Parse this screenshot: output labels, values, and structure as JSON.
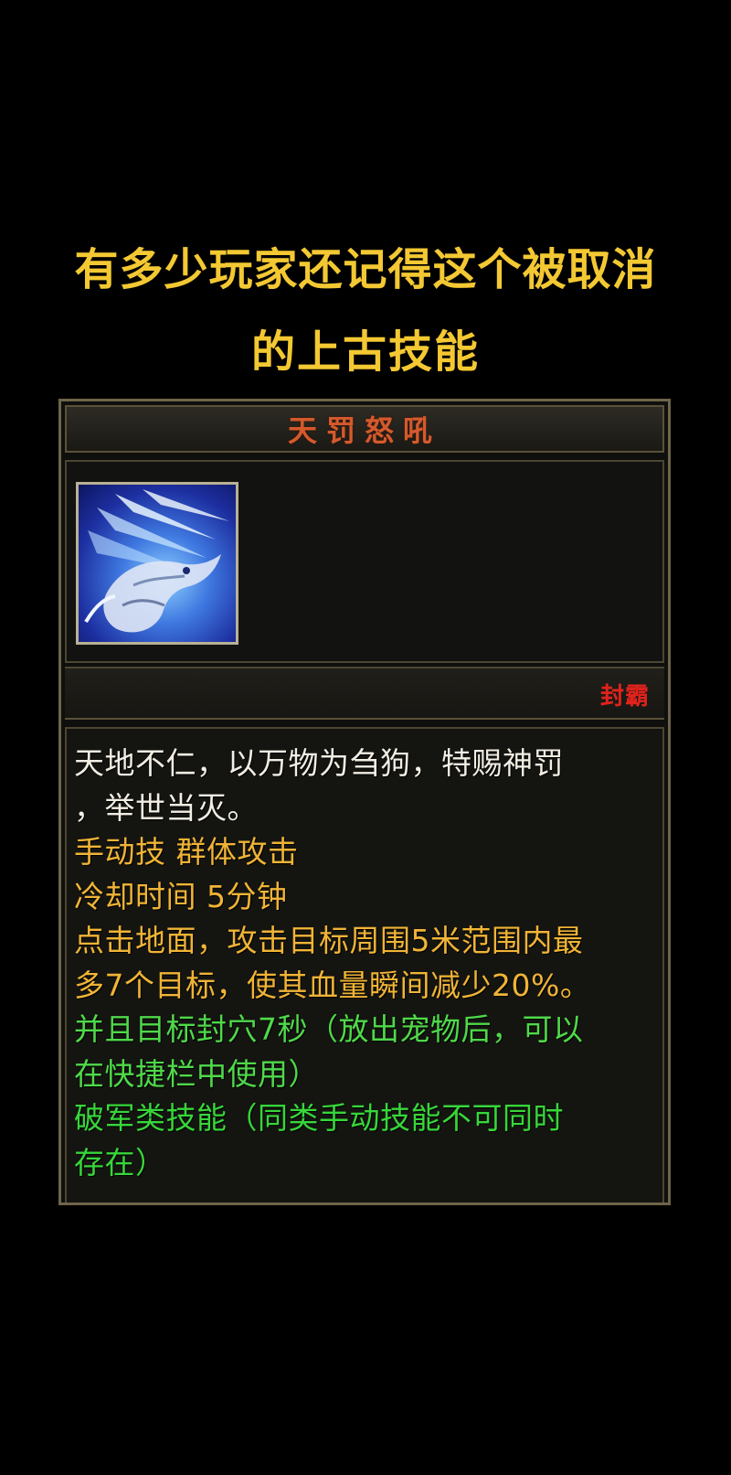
{
  "headline": {
    "line1": "有多少玩家还记得这个被取消",
    "line2": "的上古技能"
  },
  "panel": {
    "skill_name": "天罚怒吼",
    "skill_icon": "dragon-icon",
    "status_label": "封霸",
    "description": [
      {
        "text": "天地不仁，以万物为刍狗，特赐神罚",
        "color": "#f2eee4"
      },
      {
        "text": "，举世当灭。",
        "color": "#f2eee4"
      },
      {
        "text": "手动技 群体攻击",
        "color": "#f0b436"
      },
      {
        "text": "冷却时间 5分钟",
        "color": "#f0b436"
      },
      {
        "text": "点击地面，攻击目标周围5米范围内最",
        "color": "#f0b436"
      },
      {
        "text": "多7个目标，使其血量瞬间减少20%。",
        "color": "#f0b436"
      },
      {
        "text": "并且目标封穴7秒（放出宠物后，可以",
        "color": "#4fd94a"
      },
      {
        "text": "在快捷栏中使用）",
        "color": "#4fd94a"
      },
      {
        "text": "破军类技能（同类手动技能不可同时",
        "color": "#37d63a"
      },
      {
        "text": "存在）",
        "color": "#37d63a"
      }
    ]
  }
}
